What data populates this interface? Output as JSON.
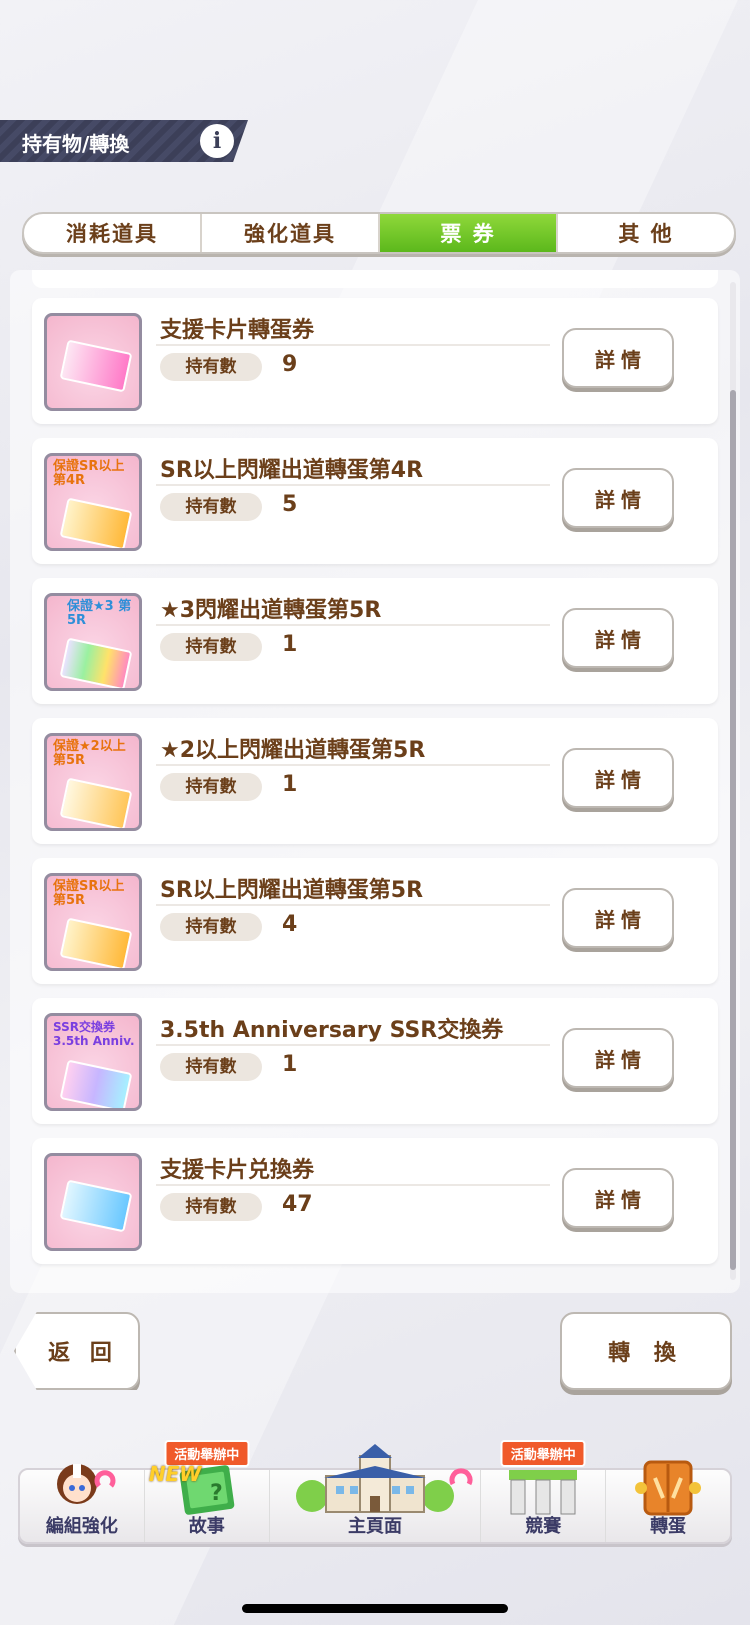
{
  "header": {
    "title": "持有物/轉換",
    "info_icon": "i"
  },
  "tabs": [
    {
      "label": "消耗道具",
      "active": false
    },
    {
      "label": "強化道具",
      "active": false
    },
    {
      "label": "票 券",
      "active": true
    },
    {
      "label": "其 他",
      "active": false
    }
  ],
  "items": [
    {
      "name": "支援卡片轉蛋券",
      "qty_label": "持有數",
      "qty": "9",
      "detail": "詳情",
      "icon": "support-card-gacha-ticket-icon",
      "icon_text": ""
    },
    {
      "name": "SR以上閃耀出道轉蛋第4R",
      "qty_label": "持有數",
      "qty": "5",
      "detail": "詳情",
      "icon": "sr-guaranteed-ticket-icon",
      "icon_text": "保證SR以上 第4R"
    },
    {
      "name": "★3閃耀出道轉蛋第5R",
      "qty_label": "持有數",
      "qty": "1",
      "detail": "詳情",
      "icon": "star3-guaranteed-ticket-icon",
      "icon_text": "保證★3 第5R"
    },
    {
      "name": "★2以上閃耀出道轉蛋第5R",
      "qty_label": "持有數",
      "qty": "1",
      "detail": "詳情",
      "icon": "star2-guaranteed-ticket-icon",
      "icon_text": "保證★2以上 第5R"
    },
    {
      "name": "SR以上閃耀出道轉蛋第5R",
      "qty_label": "持有數",
      "qty": "4",
      "detail": "詳情",
      "icon": "sr-guaranteed-ticket-icon",
      "icon_text": "保證SR以上 第5R"
    },
    {
      "name": "3.5th Anniversary SSR交換券",
      "qty_label": "持有數",
      "qty": "1",
      "detail": "詳情",
      "icon": "ssr-exchange-ticket-icon",
      "icon_text": "SSR交換券 3.5th Anniv."
    },
    {
      "name": "支援卡片兑換券",
      "qty_label": "持有數",
      "qty": "47",
      "detail": "詳情",
      "icon": "support-card-exchange-ticket-icon",
      "icon_text": ""
    }
  ],
  "buttons": {
    "back": "返 回",
    "convert": "轉 換"
  },
  "nav": [
    {
      "label": "編組強化",
      "icon": "character-icon",
      "badge": ""
    },
    {
      "label": "故事",
      "icon": "story-book-icon",
      "badge": "活動舉辦中",
      "new": "NEW"
    },
    {
      "label": "主頁面",
      "icon": "school-building-icon",
      "badge": ""
    },
    {
      "label": "競賽",
      "icon": "race-gate-icon",
      "badge": "活動舉辦中"
    },
    {
      "label": "轉蛋",
      "icon": "gacha-door-icon",
      "badge": ""
    }
  ],
  "colors": {
    "accent_green": "#5cb81c",
    "text_brown": "#6b3f1a",
    "header_dark": "#3c3f58",
    "badge_orange": "#f05a2a"
  }
}
